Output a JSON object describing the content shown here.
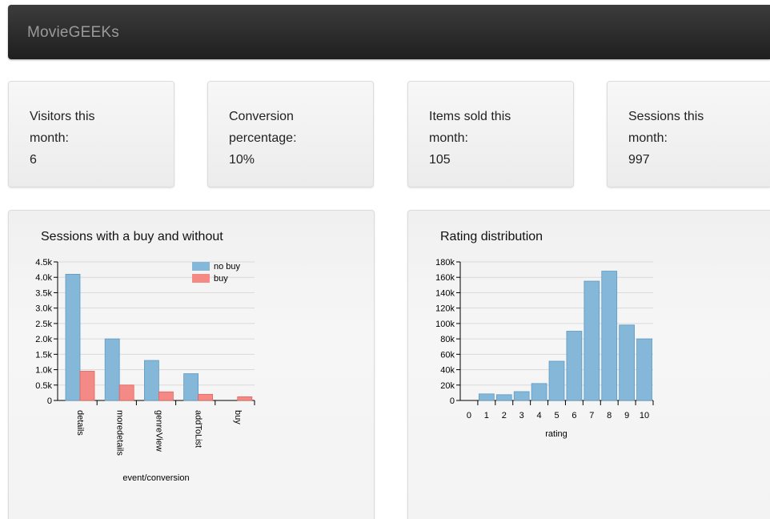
{
  "app": {
    "brand": "MovieGEEKs"
  },
  "stats": [
    {
      "label_line1": "Visitors this",
      "label_line2": "month:",
      "value": "6"
    },
    {
      "label_line1": "Conversion",
      "label_line2": "percentage:",
      "value": "10%"
    },
    {
      "label_line1": "Items sold this",
      "label_line2": "month:",
      "value": "105"
    },
    {
      "label_line1": "Sessions this",
      "label_line2": "month:",
      "value": "997"
    }
  ],
  "colors": {
    "no_buy": "#85b7d9",
    "buy": "#f48a86",
    "bar_stroke_blue": "#5e9ac4",
    "bar_stroke_red": "#e4635f"
  },
  "chart_data": [
    {
      "type": "bar",
      "title": "Sessions with a buy and without",
      "xlabel": "event/conversion",
      "ylabel": "",
      "categories": [
        "details",
        "moredetails",
        "genreView",
        "addToList",
        "buy"
      ],
      "series": [
        {
          "name": "no buy",
          "values": [
            4100,
            2000,
            1300,
            870,
            0
          ]
        },
        {
          "name": "buy",
          "values": [
            950,
            500,
            280,
            200,
            120
          ]
        }
      ],
      "ylim": [
        0,
        4500
      ],
      "yticks": [
        0,
        500,
        1000,
        1500,
        2000,
        2500,
        3000,
        3500,
        4000,
        4500
      ],
      "ytick_labels": [
        "0",
        "0.5k",
        "1.0k",
        "1.5k",
        "2.0k",
        "2.5k",
        "3.0k",
        "3.5k",
        "4.0k",
        "4.5k"
      ],
      "legend": "top-right",
      "grid": true
    },
    {
      "type": "bar",
      "title": "Rating distribution",
      "xlabel": "rating",
      "ylabel": "",
      "categories": [
        "0",
        "1",
        "2",
        "3",
        "4",
        "5",
        "6",
        "7",
        "8",
        "9",
        "10"
      ],
      "values": [
        0,
        8500,
        7500,
        11500,
        22000,
        51000,
        90000,
        155000,
        168000,
        98000,
        80000
      ],
      "ylim": [
        0,
        180000
      ],
      "yticks": [
        0,
        20000,
        40000,
        60000,
        80000,
        100000,
        120000,
        140000,
        160000,
        180000
      ],
      "ytick_labels": [
        "0",
        "20k",
        "40k",
        "60k",
        "80k",
        "100k",
        "120k",
        "140k",
        "160k",
        "180k"
      ],
      "grid": true
    }
  ]
}
